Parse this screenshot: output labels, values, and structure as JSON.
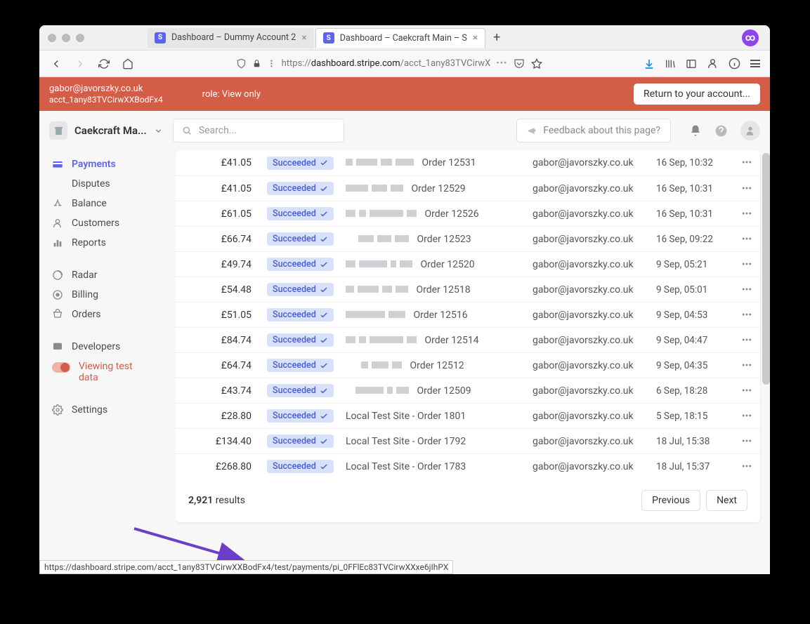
{
  "browser": {
    "tabs": [
      {
        "title": "Dashboard – Dummy Account 2"
      },
      {
        "title": "Dashboard – Caekcraft Main – S"
      }
    ],
    "url_prefix": "https://",
    "url_host": "dashboard.stripe.com",
    "url_path": "/acct_1any83TVCirwX",
    "status_url": "https://dashboard.stripe.com/acct_1any83TVCirwXXBodFx4/test/payments/pi_0FFlEc83TVCirwXXxe6jIhPX"
  },
  "impersonate": {
    "email": "gabor@javorszky.co.uk",
    "account": "acct_1any83TVCirwXXBodFx4",
    "role": "role: View only",
    "return": "Return to your account..."
  },
  "topbar": {
    "account_name": "Caekcraft Ma...",
    "search_placeholder": "Search...",
    "feedback": "Feedback about this page?"
  },
  "sidebar": {
    "payments": "Payments",
    "disputes": "Disputes",
    "balance": "Balance",
    "customers": "Customers",
    "reports": "Reports",
    "radar": "Radar",
    "billing": "Billing",
    "orders": "Orders",
    "developers": "Developers",
    "viewing_test": "Viewing test data",
    "settings": "Settings"
  },
  "status_label": "Succeeded",
  "rows": [
    {
      "amt": "£41.05",
      "desc": "Order 12531",
      "email": "gabor@javorszky.co.uk",
      "date": "16 Sep, 10:32",
      "redacted": true,
      "pattern": [
        10,
        30,
        16,
        26
      ]
    },
    {
      "amt": "£41.05",
      "desc": "Order 12529",
      "email": "gabor@javorszky.co.uk",
      "date": "16 Sep, 10:31",
      "redacted": true,
      "pattern": [
        32,
        22,
        18
      ]
    },
    {
      "amt": "£61.05",
      "desc": "Order 12526",
      "email": "gabor@javorszky.co.uk",
      "date": "16 Sep, 10:31",
      "redacted": true,
      "pattern": [
        14,
        10,
        48,
        14
      ]
    },
    {
      "amt": "£66.74",
      "desc": "Order 12523",
      "email": "gabor@javorszky.co.uk",
      "date": "16 Sep, 09:22",
      "redacted": true,
      "pattern": [
        22,
        20,
        20
      ],
      "indent": 18
    },
    {
      "amt": "£49.74",
      "desc": "Order 12520",
      "email": "gabor@javorszky.co.uk",
      "date": "9 Sep, 05:21",
      "redacted": true,
      "pattern": [
        14,
        40,
        8,
        18
      ]
    },
    {
      "amt": "£54.48",
      "desc": "Order 12518",
      "email": "gabor@javorszky.co.uk",
      "date": "9 Sep, 05:01",
      "redacted": true,
      "pattern": [
        12,
        30,
        14,
        18
      ]
    },
    {
      "amt": "£51.05",
      "desc": "Order 12516",
      "email": "gabor@javorszky.co.uk",
      "date": "9 Sep, 04:53",
      "redacted": true,
      "pattern": [
        56,
        24
      ]
    },
    {
      "amt": "£84.74",
      "desc": "Order 12514",
      "email": "gabor@javorszky.co.uk",
      "date": "9 Sep, 04:47",
      "redacted": true,
      "pattern": [
        14,
        10,
        48,
        14
      ]
    },
    {
      "amt": "£64.74",
      "desc": "Order 12512",
      "email": "gabor@javorszky.co.uk",
      "date": "9 Sep, 04:35",
      "redacted": true,
      "pattern": [
        10,
        24,
        14
      ],
      "indent": 22
    },
    {
      "amt": "£43.74",
      "desc": "Order 12509",
      "email": "gabor@javorszky.co.uk",
      "date": "6 Sep, 18:28",
      "redacted": true,
      "pattern": [
        40,
        8,
        18
      ],
      "indent": 14
    },
    {
      "amt": "£28.80",
      "desc": "Local Test Site - Order 1801",
      "email": "gabor@javorszky.co.uk",
      "date": "5 Sep, 18:15",
      "redacted": false
    },
    {
      "amt": "£134.40",
      "desc": "Local Test Site - Order 1792",
      "email": "gabor@javorszky.co.uk",
      "date": "18 Jul, 15:38",
      "redacted": false
    },
    {
      "amt": "£268.80",
      "desc": "Local Test Site - Order 1783",
      "email": "gabor@javorszky.co.uk",
      "date": "18 Jul, 15:37",
      "redacted": false
    }
  ],
  "footer": {
    "count": "2,921",
    "results": " results",
    "prev": "Previous",
    "next": "Next"
  }
}
